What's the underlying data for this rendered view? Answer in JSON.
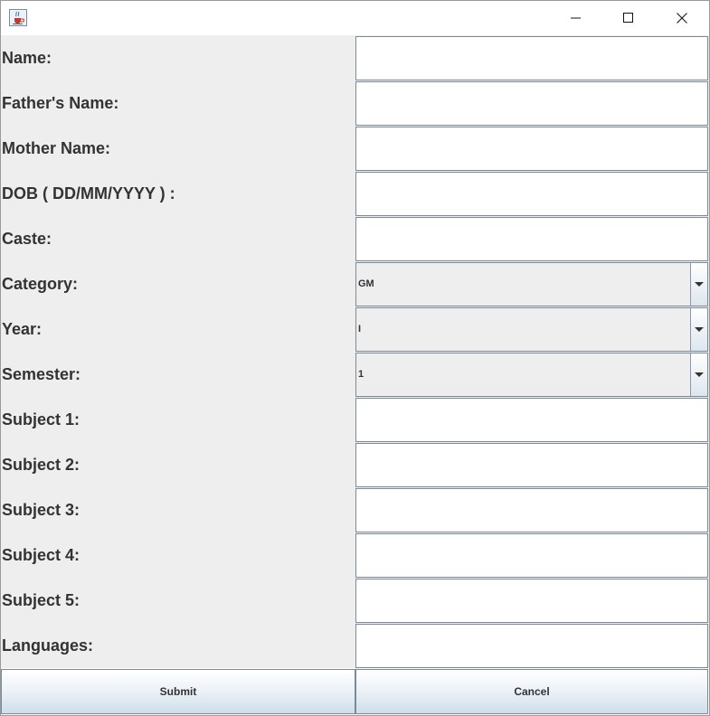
{
  "window": {
    "controls": {
      "minimize_icon": "minimize-icon",
      "maximize_icon": "maximize-icon",
      "close_icon": "close-icon"
    },
    "app_icon": "java-cup-icon"
  },
  "form": {
    "fields": [
      {
        "label": "Name:",
        "type": "text",
        "value": ""
      },
      {
        "label": "Father's Name:",
        "type": "text",
        "value": ""
      },
      {
        "label": "Mother Name:",
        "type": "text",
        "value": ""
      },
      {
        "label": "DOB ( DD/MM/YYYY ) :",
        "type": "text",
        "value": ""
      },
      {
        "label": "Caste:",
        "type": "text",
        "value": ""
      },
      {
        "label": "Category:",
        "type": "select",
        "value": "GM"
      },
      {
        "label": "Year:",
        "type": "select",
        "value": "I"
      },
      {
        "label": "Semester:",
        "type": "select",
        "value": "1"
      },
      {
        "label": "Subject 1:",
        "type": "text",
        "value": ""
      },
      {
        "label": "Subject 2:",
        "type": "text",
        "value": ""
      },
      {
        "label": "Subject 3:",
        "type": "text",
        "value": ""
      },
      {
        "label": "Subject 4:",
        "type": "text",
        "value": ""
      },
      {
        "label": "Subject 5:",
        "type": "text",
        "value": ""
      },
      {
        "label": "Languages:",
        "type": "text",
        "value": ""
      }
    ]
  },
  "buttons": {
    "submit": "Submit",
    "cancel": "Cancel"
  }
}
